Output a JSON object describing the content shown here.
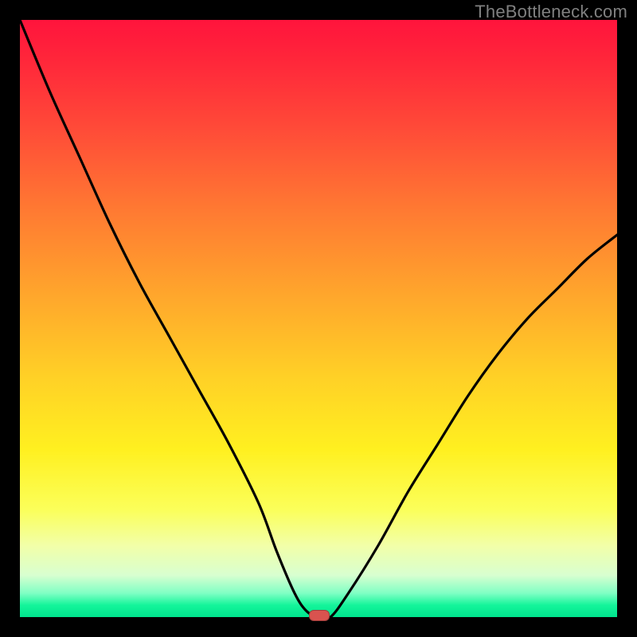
{
  "watermark": "TheBottleneck.com",
  "colors": {
    "background_frame": "#000000",
    "gradient_top": "#ff143c",
    "gradient_bottom": "#00e48e",
    "curve": "#000000",
    "marker": "#d9534f"
  },
  "chart_data": {
    "type": "line",
    "title": "",
    "xlabel": "",
    "ylabel": "",
    "xlim": [
      0,
      100
    ],
    "ylim": [
      0,
      100
    ],
    "grid": false,
    "legend": false,
    "series": [
      {
        "name": "bottleneck-curve",
        "x": [
          0,
          5,
          10,
          15,
          20,
          25,
          30,
          35,
          40,
          43,
          46,
          48,
          50,
          52,
          55,
          60,
          65,
          70,
          75,
          80,
          85,
          90,
          95,
          100
        ],
        "y": [
          100,
          88,
          77,
          66,
          56,
          47,
          38,
          29,
          19,
          11,
          4,
          1,
          0,
          0,
          4,
          12,
          21,
          29,
          37,
          44,
          50,
          55,
          60,
          64
        ]
      }
    ],
    "annotations": [
      {
        "name": "optimum-marker",
        "x": 50,
        "y": 0,
        "shape": "pill",
        "color": "#d9534f"
      }
    ]
  }
}
